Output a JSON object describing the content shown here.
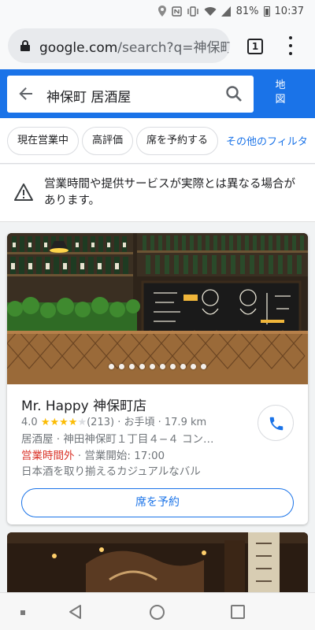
{
  "status_bar": {
    "battery_percent": "81%",
    "time": "10:37",
    "icons": [
      "location-icon",
      "nfc-icon",
      "vibrate-icon",
      "wifi-icon",
      "signal-icon",
      "battery-icon"
    ]
  },
  "browser": {
    "url_host": "google.com",
    "url_path": "/search?q=神保町",
    "tab_count": "1"
  },
  "search": {
    "query": "神保町 居酒屋",
    "map_label": "地図"
  },
  "chips": [
    "現在営業中",
    "高評価",
    "席を予約する"
  ],
  "chips_more": "その他のフィルタ",
  "warning": {
    "text": "営業時間や提供サービスが実際とは異なる場合があります。"
  },
  "listing": {
    "name": "Mr.  Happy 神保町店",
    "rating": "4.0",
    "stars_filled": 4,
    "stars_total": 5,
    "review_count": "(213)",
    "price": "· お手頃 ·",
    "distance": "17.9 km",
    "category_address": "居酒屋 · 神田神保町１丁目４−４ コン…",
    "status_closed": "営業時間外",
    "status_open": " · 営業開始: 17:00",
    "description": "日本酒を取り揃えるカジュアルなバル",
    "reserve_label": "席を予約",
    "photo_count": 10
  },
  "colors": {
    "accent": "#1a73e8",
    "closed_red": "#d93025",
    "star_yellow": "#fbbc04"
  }
}
